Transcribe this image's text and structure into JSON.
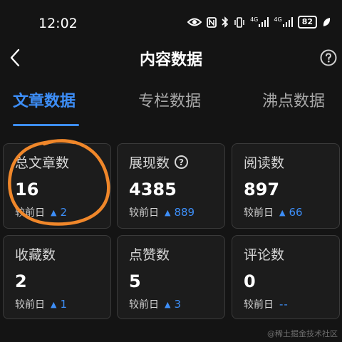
{
  "status_bar": {
    "time": "12:02",
    "signal1": "4G",
    "signal2": "4G",
    "battery": "82"
  },
  "header": {
    "title": "内容数据"
  },
  "tabs": [
    {
      "label": "文章数据",
      "active": true
    },
    {
      "label": "专栏数据",
      "active": false
    },
    {
      "label": "沸点数据",
      "active": false
    }
  ],
  "cards": [
    {
      "label": "总文章数",
      "value": "16",
      "compare_label": "较前日",
      "change": "2"
    },
    {
      "label": "展现数",
      "value": "4385",
      "compare_label": "较前日",
      "change": "889"
    },
    {
      "label": "阅读数",
      "value": "897",
      "compare_label": "较前日",
      "change": "66"
    },
    {
      "label": "收藏数",
      "value": "2",
      "compare_label": "较前日",
      "change": "1"
    },
    {
      "label": "点赞数",
      "value": "5",
      "compare_label": "较前日",
      "change": "3"
    },
    {
      "label": "评论数",
      "value": "0",
      "compare_label": "较前日",
      "change": "--"
    }
  ],
  "watermark": "@稀土掘金技术社区",
  "colors": {
    "background": "#141414",
    "card": "#1c1c1c",
    "accent": "#3d8ef7",
    "annotation": "#f0872a"
  }
}
